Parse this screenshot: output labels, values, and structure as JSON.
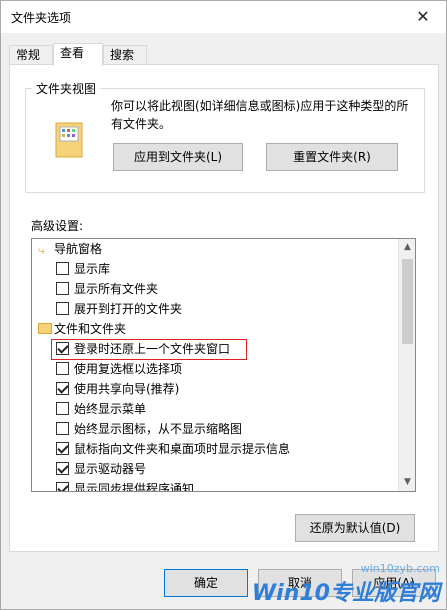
{
  "window": {
    "title": "文件夹选项",
    "close_glyph": "✕"
  },
  "tabs": [
    {
      "label": "常规",
      "active": false
    },
    {
      "label": "查看",
      "active": true
    },
    {
      "label": "搜索",
      "active": false
    }
  ],
  "folder_views": {
    "title": "文件夹视图",
    "description": "你可以将此视图(如详细信息或图标)应用于这种类型的所有文件夹。",
    "apply_button": "应用到文件夹(L)",
    "reset_button": "重置文件夹(R)"
  },
  "advanced": {
    "label": "高级设置:",
    "items": [
      {
        "type": "group",
        "icon": "navigation-pane-icon",
        "label": "导航窗格"
      },
      {
        "type": "checkbox",
        "label": "显示库",
        "checked": false
      },
      {
        "type": "checkbox",
        "label": "显示所有文件夹",
        "checked": false
      },
      {
        "type": "checkbox",
        "label": "展开到打开的文件夹",
        "checked": false
      },
      {
        "type": "group",
        "icon": "folder-icon",
        "label": "文件和文件夹"
      },
      {
        "type": "checkbox",
        "label": "登录时还原上一个文件夹窗口",
        "checked": true,
        "highlighted": true
      },
      {
        "type": "checkbox",
        "label": "使用复选框以选择项",
        "checked": false
      },
      {
        "type": "checkbox",
        "label": "使用共享向导(推荐)",
        "checked": true
      },
      {
        "type": "checkbox",
        "label": "始终显示菜单",
        "checked": false
      },
      {
        "type": "checkbox",
        "label": "始终显示图标，从不显示缩略图",
        "checked": false
      },
      {
        "type": "checkbox",
        "label": "鼠标指向文件夹和桌面项时显示提示信息",
        "checked": true
      },
      {
        "type": "checkbox",
        "label": "显示驱动器号",
        "checked": true
      },
      {
        "type": "checkbox",
        "label": "显示同步提供程序通知",
        "checked": true
      }
    ],
    "restore_button": "还原为默认值(D)"
  },
  "footer": {
    "ok": "确定",
    "cancel": "取消",
    "apply": "应用(A)"
  },
  "watermark": {
    "main": "Win10专业版官网",
    "sub": "win10zyb.com"
  },
  "colors": {
    "highlight": "#e02020",
    "accent": "#0078d7"
  }
}
